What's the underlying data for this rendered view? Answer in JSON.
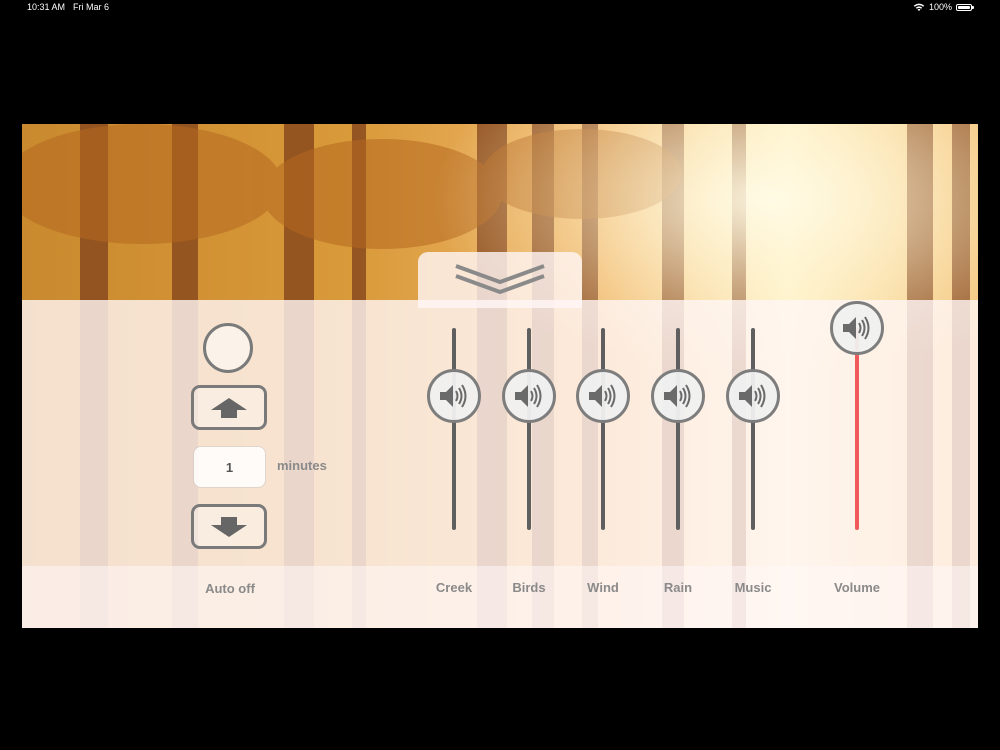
{
  "status_bar": {
    "time": "10:31 AM",
    "date": "Fri Mar 6",
    "battery": "100%",
    "wifi_icon": "wifi-icon",
    "battery_icon": "battery-icon"
  },
  "auto_off": {
    "minutes_value": "1",
    "minutes_label": "minutes",
    "label": "Auto off"
  },
  "sliders": [
    {
      "label": "Creek",
      "icon": "speaker-icon",
      "level": 0.72
    },
    {
      "label": "Birds",
      "icon": "speaker-icon",
      "level": 0.72
    },
    {
      "label": "Wind",
      "icon": "speaker-icon",
      "level": 0.72
    },
    {
      "label": "Rain",
      "icon": "speaker-icon",
      "level": 0.72
    },
    {
      "label": "Music",
      "icon": "speaker-icon",
      "level": 0.72
    }
  ],
  "volume": {
    "label": "Volume",
    "icon": "speaker-icon",
    "level": 1.0,
    "color": "#f05a5a"
  },
  "colors": {
    "accent": "#f05a5a",
    "control_gray": "#7a7a7a",
    "label_gray": "#8a8a8a"
  }
}
